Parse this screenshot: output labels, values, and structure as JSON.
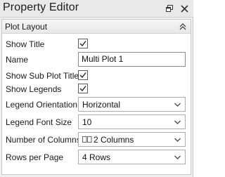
{
  "window": {
    "title": "Property Editor",
    "pin_icon": "pin-icon",
    "close_icon": "close-icon"
  },
  "section": {
    "title": "Plot Layout",
    "collapse_icon": "double-chevron-up-icon"
  },
  "properties": {
    "show_title": {
      "label": "Show Title",
      "checked": true
    },
    "name": {
      "label": "Name",
      "value": "Multi Plot 1"
    },
    "show_sub_plot_titles": {
      "label": "Show Sub Plot Titles",
      "checked": true
    },
    "show_legends": {
      "label": "Show Legends",
      "checked": true
    },
    "legend_orientation": {
      "label": "Legend Orientation",
      "value": "Horizontal"
    },
    "legend_font_size": {
      "label": "Legend Font Size",
      "value": "10"
    },
    "number_of_columns": {
      "label": "Number of Columns",
      "value": "2 Columns",
      "icon": "two-columns-icon"
    },
    "rows_per_page": {
      "label": "Rows per Page",
      "value": "4 Rows"
    }
  },
  "colors": {
    "titlebar_bg": "#e9e9e9",
    "section_header_bg": "#eeeeee",
    "panel_bg": "#ffffff",
    "border": "#c9c9c9"
  }
}
